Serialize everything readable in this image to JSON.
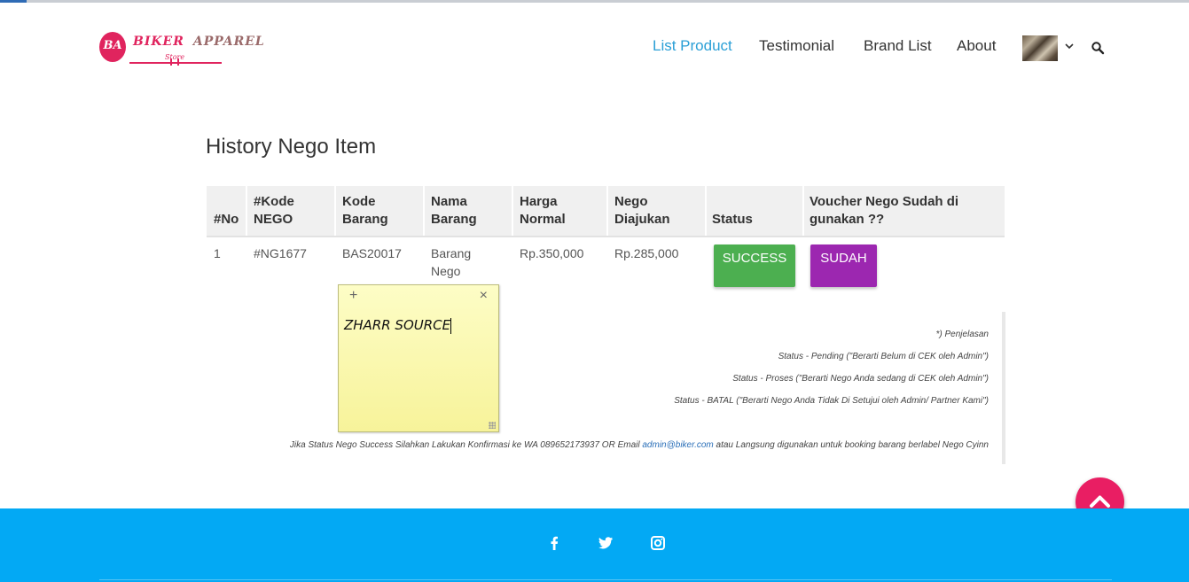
{
  "brand": {
    "monogram": "BA",
    "name_part1": "BIKER",
    "name_part2": "APPAREL",
    "tagline": "Store"
  },
  "nav": {
    "items": [
      {
        "label": "List Product",
        "active": true
      },
      {
        "label": "Testimonial",
        "active": false
      },
      {
        "label": "Brand List",
        "active": false
      },
      {
        "label": "About",
        "active": false
      }
    ],
    "avatar_icon": "user-avatar",
    "dropdown_icon": "chevron-down-icon",
    "search_icon": "search-icon"
  },
  "page": {
    "title": "History Nego Item"
  },
  "table": {
    "headers": [
      {
        "line1": "",
        "line2": "#No"
      },
      {
        "line1": "#Kode",
        "line2": "NEGO"
      },
      {
        "line1": "Kode",
        "line2": "Barang"
      },
      {
        "line1": "Nama",
        "line2": "Barang"
      },
      {
        "line1": "Harga",
        "line2": "Normal"
      },
      {
        "line1": "Nego",
        "line2": "Diajukan"
      },
      {
        "line1": "",
        "line2": "Status"
      },
      {
        "line1": "Voucher Nego Sudah di",
        "line2": "gunakan ??"
      }
    ],
    "rows": [
      {
        "no": "1",
        "kode_nego": "#NG1677",
        "kode_barang": "BAS20017",
        "nama_barang_line1": "Barang",
        "nama_barang_line2": "Nego",
        "harga_normal": "Rp.350,000",
        "nego_diajukan": "Rp.285,000",
        "status": "SUCCESS",
        "voucher": "SUDAH"
      }
    ]
  },
  "notes": {
    "heading": "*) Penjelasan",
    "pending": "Status - Pending (\"Berarti Belum di CEK oleh Admin\")",
    "proses": "Status - Proses (\"Berarti Nego Anda sedang di CEK oleh Admin\")",
    "batal": "Status - BATAL (\"Berarti Nego Anda Tidak Di Setujui oleh Admin/ Partner Kami\")",
    "info_before": "Jika Status Nego Success Silahkan Lakukan Konfirmasi ke WA 089652173937 OR Email",
    "email": "admin@biker.com",
    "info_after": "atau Langsung digunakan untuk booking barang berlabel Nego Cyinn"
  },
  "sticky_note": {
    "add": "+",
    "close": "×",
    "text": "ZHARR SOURCE"
  },
  "colors": {
    "accent": "#2a9fd6",
    "success": "#4caf50",
    "sudah": "#9c27b0",
    "scroll_top": "#e91e63",
    "footer": "#03a9f4"
  },
  "footer": {
    "social": [
      "facebook-icon",
      "twitter-icon",
      "instagram-icon"
    ]
  }
}
